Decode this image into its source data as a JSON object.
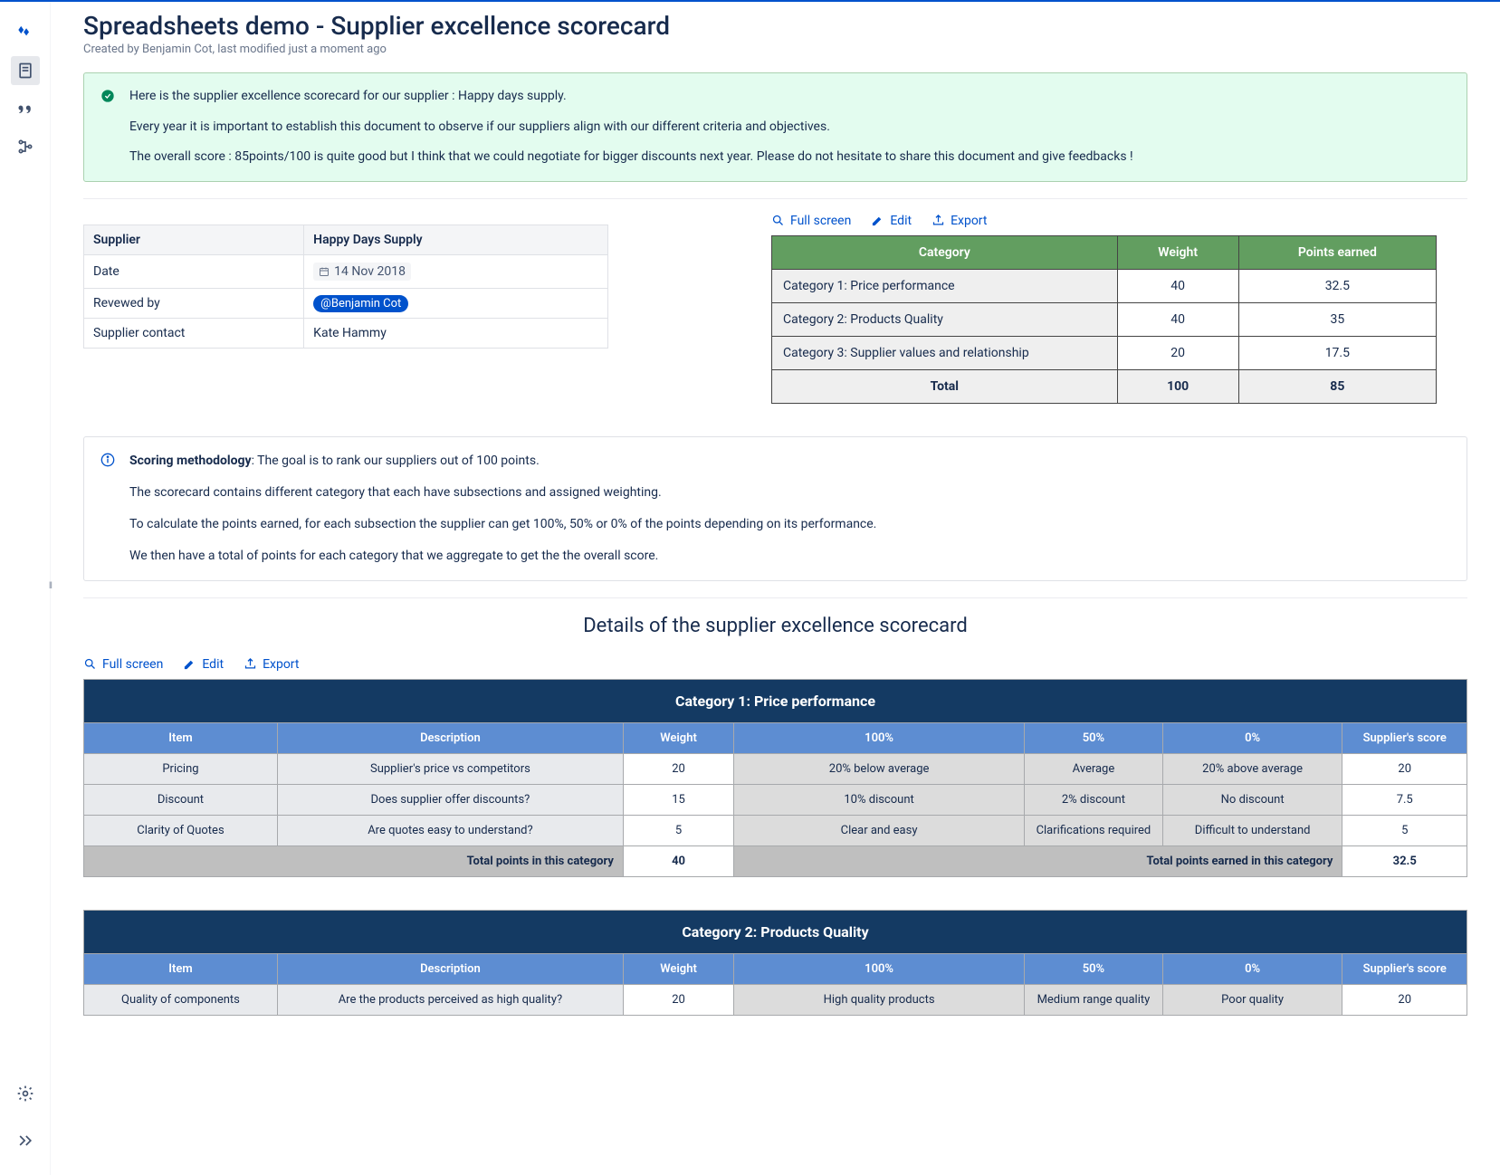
{
  "page": {
    "title": "Spreadsheets demo - Supplier excellence scorecard",
    "byline": "Created by Benjamin Cot, last modified just a moment ago"
  },
  "success_panel": {
    "line1": "Here is the supplier excellence scorecard for our supplier : Happy days supply.",
    "line2": "Every year it is important to establish this document to observe if our suppliers align with our different criteria and objectives.",
    "line3": "The overall score : 85points/100 is quite good but I think that we could negotiate for bigger discounts next year. Please do not hesitate to share this document and give feedbacks !"
  },
  "info_table": {
    "h1": "Supplier",
    "h2": "Happy Days Supply",
    "r1a": "Date",
    "r1b": "14 Nov 2018",
    "r2a": "Revewed by",
    "r2b": "@Benjamin Cot",
    "r3a": "Supplier contact",
    "r3b": "Kate Hammy"
  },
  "actions": {
    "fullscreen": "Full screen",
    "edit": "Edit",
    "export": "Export"
  },
  "summary": {
    "h_cat": "Category",
    "h_weight": "Weight",
    "h_points": "Points earned",
    "rows": [
      {
        "cat": "Category 1: Price performance",
        "w": "40",
        "p": "32.5"
      },
      {
        "cat": "Category 2: Products Quality",
        "w": "40",
        "p": "35"
      },
      {
        "cat": "Category 3: Supplier values and relationship",
        "w": "20",
        "p": "17.5"
      }
    ],
    "total_label": "Total",
    "total_w": "100",
    "total_p": "85"
  },
  "methodology": {
    "lead": "Scoring methodology",
    "lead_rest": ": The goal is to rank our suppliers out of 100 points.",
    "l2": "The scorecard contains different category that each have subsections and assigned weighting.",
    "l3": "To calculate the points earned, for each subsection the supplier can get 100%, 50% or 0% of the points depending on its performance.",
    "l4": "We then have a total of points for each category that we aggregate to get the the overall score."
  },
  "section_title": "Details of the supplier excellence scorecard",
  "detail_headers": {
    "item": "Item",
    "desc": "Description",
    "weight": "Weight",
    "p100": "100%",
    "p50": "50%",
    "p0": "0%",
    "score": "Supplier's score",
    "total_weight": "Total points in this category",
    "total_earned": "Total points earned in this category"
  },
  "cat1": {
    "title": "Category 1: Price performance",
    "rows": [
      {
        "item": "Pricing",
        "desc": "Supplier's price vs competitors",
        "w": "20",
        "p100": "20% below average",
        "p50": "Average",
        "p0": "20% above average",
        "score": "20"
      },
      {
        "item": "Discount",
        "desc": "Does supplier offer discounts?",
        "w": "15",
        "p100": "10% discount",
        "p50": "2% discount",
        "p0": "No discount",
        "score": "7.5"
      },
      {
        "item": "Clarity of Quotes",
        "desc": "Are quotes easy to understand?",
        "w": "5",
        "p100": "Clear and easy",
        "p50": "Clarifications required",
        "p0": "Difficult to understand",
        "score": "5"
      }
    ],
    "total_w": "40",
    "total_p": "32.5"
  },
  "cat2": {
    "title": "Category 2: Products Quality",
    "rows": [
      {
        "item": "Quality of components",
        "desc": "Are the products perceived as high quality?",
        "w": "20",
        "p100": "High quality products",
        "p50": "Medium range quality",
        "p0": "Poor quality",
        "score": "20"
      }
    ]
  }
}
